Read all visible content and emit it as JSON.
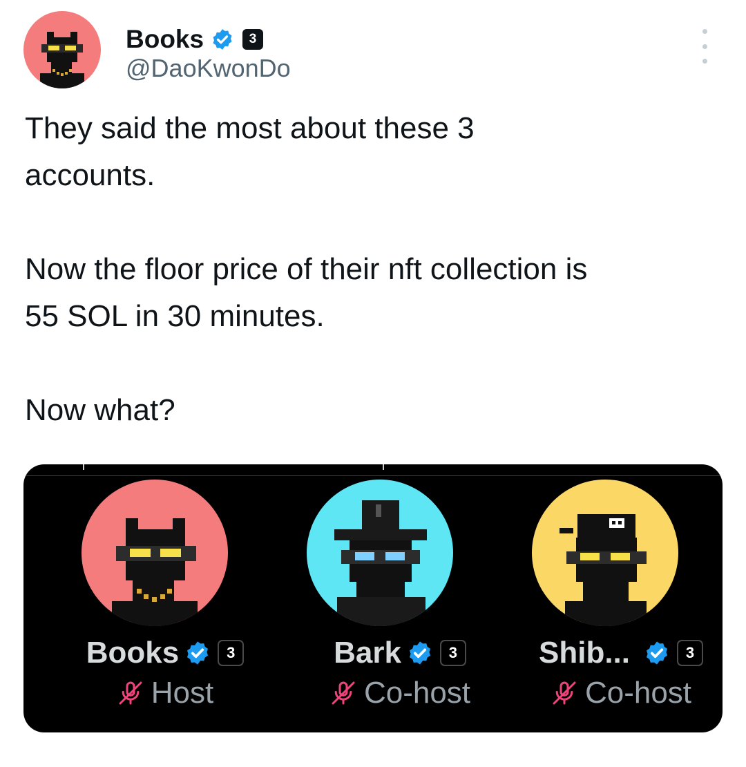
{
  "author": {
    "display_name": "Books",
    "handle": "@DaoKwonDo",
    "affiliate_badge": "3",
    "avatar_color": "#f47c7c"
  },
  "tweet": {
    "text": "They said the most about these 3\naccounts.\n\nNow the floor price of their nft collection is\n55 SOL in 30 minutes.\n\nNow what?"
  },
  "space": {
    "speakers": [
      {
        "name": "Books",
        "role": "Host",
        "badge": "3",
        "avatar_color": "#f47c7c",
        "accessory": "chain"
      },
      {
        "name": "Bark",
        "role": "Co-host",
        "badge": "3",
        "avatar_color": "#5ee6f5",
        "accessory": "hat"
      },
      {
        "name": "Shib...",
        "role": "Co-host",
        "badge": "3",
        "avatar_color": "#fbd866",
        "accessory": "pirate"
      }
    ]
  },
  "colors": {
    "verified": "#1d9bf0",
    "muted_mic": "#f0437a",
    "text_primary": "#0f1419",
    "text_secondary": "#536471"
  }
}
